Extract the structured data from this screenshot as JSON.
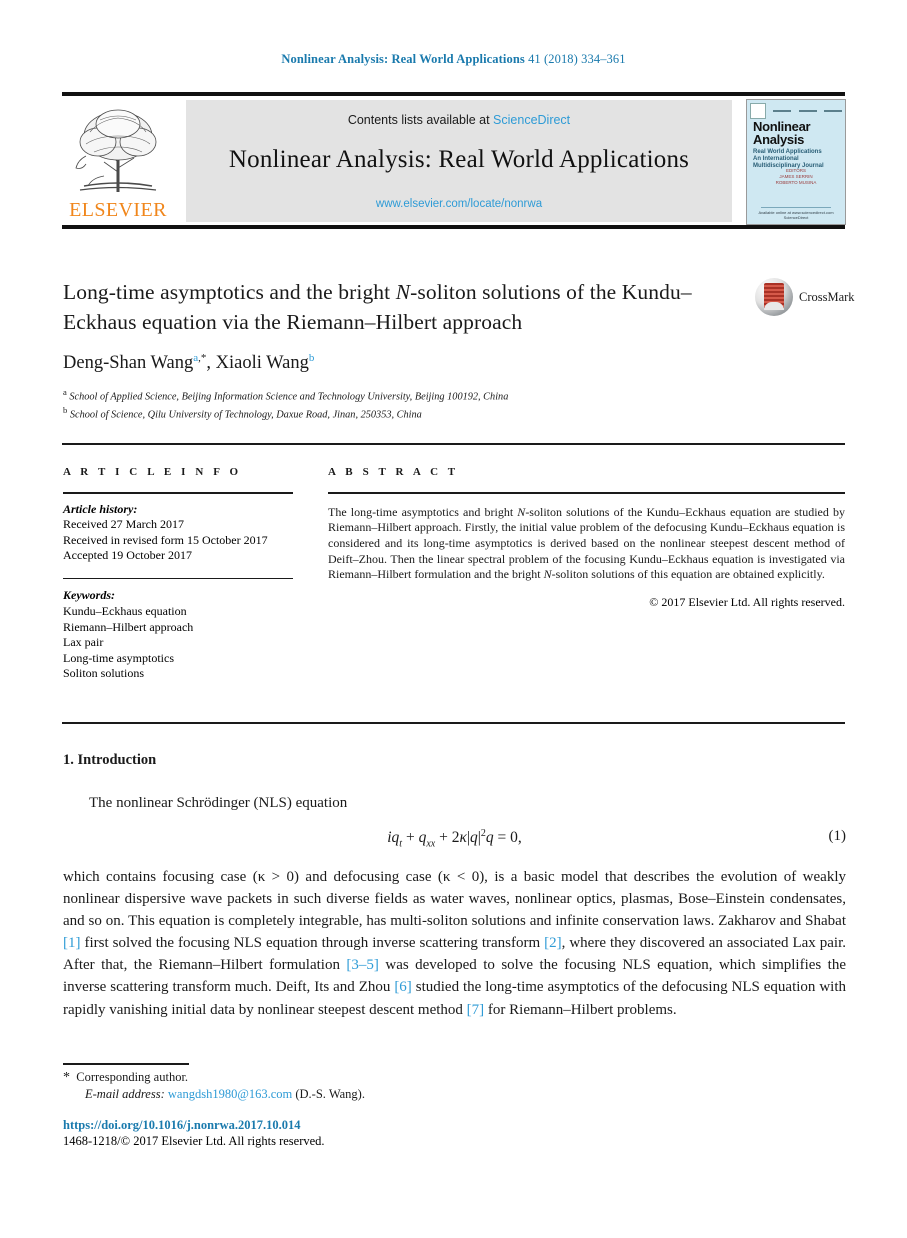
{
  "running_head": {
    "journal": "Nonlinear Analysis: Real World Applications",
    "citation": " 41 (2018) 334–361"
  },
  "masthead": {
    "publisher_logo_text": "ELSEVIER",
    "contents_prefix": "Contents lists available at ",
    "contents_link": "ScienceDirect",
    "journal_title": "Nonlinear Analysis: Real World Applications",
    "journal_url": "www.elsevier.com/locate/nonrwa",
    "cover": {
      "title_line1": "Nonlinear",
      "title_line2": "Analysis",
      "subtitle": "Real World Applications",
      "subtitle2": "An International Multidisciplinary Journal",
      "editors_label": "EDITORS",
      "editor1": "JAMES SERRIN",
      "editor2": "ROBERTO MUSINA",
      "footer1": "Available online at www.sciencedirect.com",
      "footer2": "ScienceDirect"
    }
  },
  "article": {
    "title_part1": "Long-time asymptotics and the bright ",
    "title_italic": "N",
    "title_part2": "-soliton solutions of the Kundu–Eckhaus equation via the Riemann–Hilbert approach",
    "crossmark_label": "CrossMark",
    "author1": "Deng-Shan Wang",
    "author1_sup": "a",
    "author1_star": ",*",
    "author_sep": ", ",
    "author2": "Xiaoli Wang",
    "author2_sup": "b",
    "affiliation_a_sup": "a",
    "affiliation_a": " School of Applied Science, Beijing Information Science and Technology University, Beijing 100192, China",
    "affiliation_b_sup": "b",
    "affiliation_b": " School of Science, Qilu University of Technology, Daxue Road, Jinan, 250353, China"
  },
  "article_info": {
    "heading": "A R T I C L E   I N F O",
    "history_label": "Article history:",
    "history": [
      "Received 27 March 2017",
      "Received in revised form 15 October 2017",
      "Accepted 19 October 2017"
    ],
    "keywords_label": "Keywords:",
    "keywords": [
      "Kundu–Eckhaus equation",
      "Riemann–Hilbert approach",
      "Lax pair",
      "Long-time asymptotics",
      "Soliton solutions"
    ]
  },
  "abstract": {
    "heading": "A B S T R A C T",
    "text_1": "The long-time asymptotics and bright ",
    "text_italic_1": "N",
    "text_2": "-soliton solutions of the Kundu–Eckhaus equation are studied by Riemann–Hilbert approach. Firstly, the initial value problem of the defocusing Kundu–Eckhaus equation is considered and its long-time asymptotics is derived based on the nonlinear steepest descent method of Deift–Zhou. Then the linear spectral problem of the focusing Kundu–Eckhaus equation is investigated via Riemann–Hilbert formulation and the bright ",
    "text_italic_2": "N",
    "text_3": "-soliton solutions of this equation are obtained explicitly.",
    "copyright": "© 2017 Elsevier Ltd. All rights reserved."
  },
  "body": {
    "section_heading": "1. Introduction",
    "lead_paragraph": "The nonlinear Schrödinger (NLS) equation",
    "equation": {
      "lhs_i": "i",
      "q1": "q",
      "sub_t": "t",
      "plus1": " + ",
      "q2": "q",
      "sub_xx": "xx",
      "plus2": " + 2",
      "kappa": "κ",
      "abs_open": "|",
      "q3": "q",
      "abs_close": "|",
      "sup2": "2",
      "q4": "q",
      "eq_zero": " = 0,",
      "number": "(1)"
    },
    "paragraph_1": "which contains focusing case (κ > 0) and defocusing case (κ < 0), is a basic model that describes the evolution of weakly nonlinear dispersive wave packets in such diverse fields as water waves, nonlinear optics, plasmas, Bose–Einstein condensates, and so on. This equation is completely integrable, has multi-soliton solutions and infinite conservation laws. Zakharov and Shabat ",
    "ref_1": "[1]",
    "paragraph_2": " first solved the focusing NLS equation through inverse scattering transform ",
    "ref_2": "[2]",
    "paragraph_3": ", where they discovered an associated Lax pair. After that, the Riemann–Hilbert formulation ",
    "ref_3": "[3–5]",
    "paragraph_4": " was developed to solve the focusing NLS equation, which simplifies the inverse scattering transform much. Deift, Its and Zhou ",
    "ref_4": "[6]",
    "paragraph_5": " studied the long-time asymptotics of the defocusing NLS equation with rapidly vanishing initial data by nonlinear steepest descent method ",
    "ref_5": "[7]",
    "paragraph_6": " for Riemann–Hilbert problems."
  },
  "footnote": {
    "star": "*",
    "corresponding": "Corresponding author.",
    "email_label": "E-mail address:",
    "email": "wangdsh1980@163.com",
    "email_attrib": " (D.-S. Wang).",
    "doi": "https://doi.org/10.1016/j.nonrwa.2017.10.014",
    "copyright_line": "1468-1218/© 2017 Elsevier Ltd. All rights reserved."
  },
  "colors": {
    "link": "#2e9bd6",
    "runhead": "#1a7aad",
    "elsevier_orange": "#f0861b",
    "cover_bg": "#cfe8f2",
    "band_grey": "#e3e3e3"
  }
}
